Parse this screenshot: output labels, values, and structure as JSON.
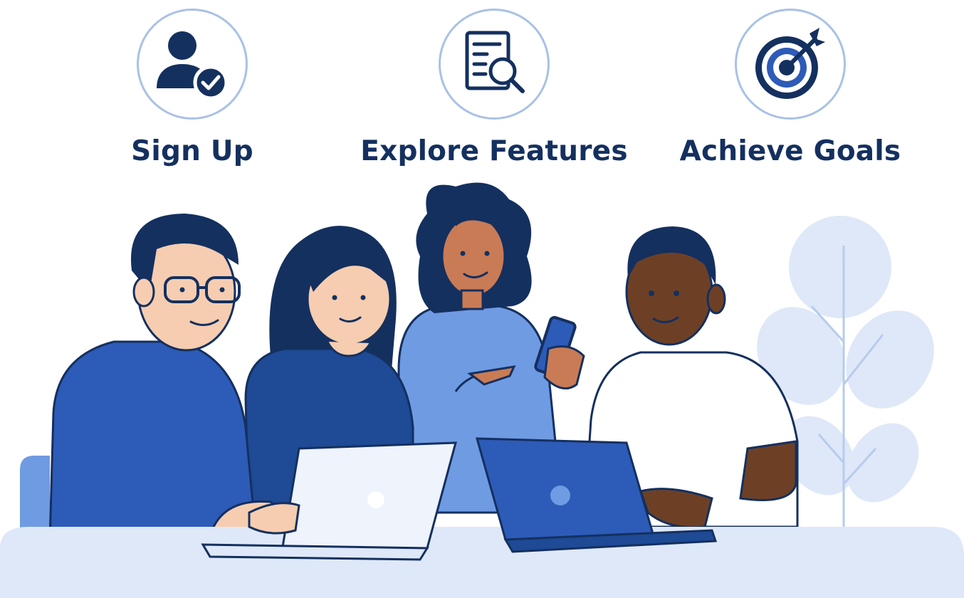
{
  "steps": [
    {
      "label": "Sign Up",
      "icon": "user-check-icon"
    },
    {
      "label": "Explore Features",
      "icon": "document-search-icon"
    },
    {
      "label": "Achieve Goals",
      "icon": "target-arrow-icon"
    }
  ],
  "colors": {
    "navy": "#14305f",
    "primary": "#2d5bb8",
    "light_blue": "#6f9be3",
    "pale_blue": "#dfe8f8",
    "ring": "#a9c1e6"
  }
}
